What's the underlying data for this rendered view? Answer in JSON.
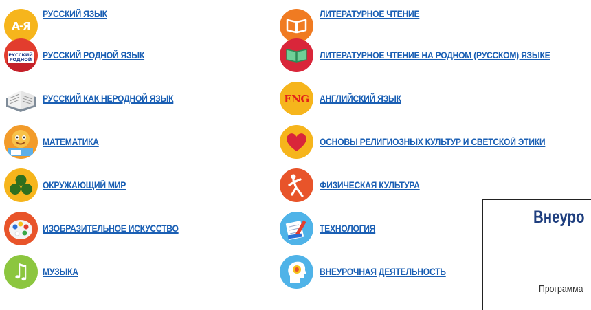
{
  "left_subjects": [
    {
      "label": "РУССКИЙ ЯЗЫК",
      "icon": "az-letters-icon",
      "color": "#f6b51c",
      "glyph": "А-Я"
    },
    {
      "label": "РУССКИЙ РОДНОЙ ЯЗЫК",
      "icon": "book-russian-native-icon",
      "color": "#e23d2e",
      "glyph": "РУССКИЙ РОДНОЙ"
    },
    {
      "label": "РУССКИЙ КАК НЕРОДНОЙ ЯЗЫК",
      "icon": "open-book-icon",
      "color": "#9aa9b7",
      "glyph": ""
    },
    {
      "label": "МАТЕМАТИКА",
      "icon": "cartoon-character-icon",
      "color": "#f29b2a",
      "glyph": ""
    },
    {
      "label": "ОКРУЖАЮЩИЙ МИР",
      "icon": "leaves-icon",
      "color": "#f6b51c",
      "glyph": ""
    },
    {
      "label": "ИЗОБРАЗИТЕЛЬНОЕ ИСКУССТВО",
      "icon": "palette-icon",
      "color": "#e8542a",
      "glyph": ""
    },
    {
      "label": "МУЗЫКА",
      "icon": "treble-clef-icon",
      "color": "#8cc63f",
      "glyph": "𝄞"
    }
  ],
  "right_subjects": [
    {
      "label": "ЛИТЕРАТУРНОЕ ЧТЕНИЕ",
      "icon": "book-icon",
      "color": "#f07b22",
      "glyph": ""
    },
    {
      "label": "ЛИТЕРАТУРНОЕ ЧТЕНИЕ НА РОДНОМ (РУССКОМ) ЯЗЫКЕ",
      "icon": "book-native-icon",
      "color": "#d9263a",
      "glyph": ""
    },
    {
      "label": "АНГЛИЙСКИЙ ЯЗЫК",
      "icon": "eng-icon",
      "color": "#f6b51c",
      "glyph": "ENG"
    },
    {
      "label": "ОСНОВЫ РЕЛИГИОЗНЫХ КУЛЬТУР И СВЕТСКОЙ ЭТИКИ",
      "icon": "heart-icon",
      "color": "#f6b51c",
      "glyph": ""
    },
    {
      "label": "ФИЗИЧЕСКАЯ КУЛЬТУРА",
      "icon": "athlete-icon",
      "color": "#e8542a",
      "glyph": ""
    },
    {
      "label": "ТЕХНОЛОГИЯ",
      "icon": "tools-icon",
      "color": "#4fb3e8",
      "glyph": ""
    },
    {
      "label": "ВНЕУРОЧНАЯ ДЕЯТЕЛЬНОСТЬ",
      "icon": "brain-head-icon",
      "color": "#4fb3e8",
      "glyph": ""
    }
  ],
  "panel": {
    "title": "Внеуро",
    "subtitle": "Программа"
  }
}
